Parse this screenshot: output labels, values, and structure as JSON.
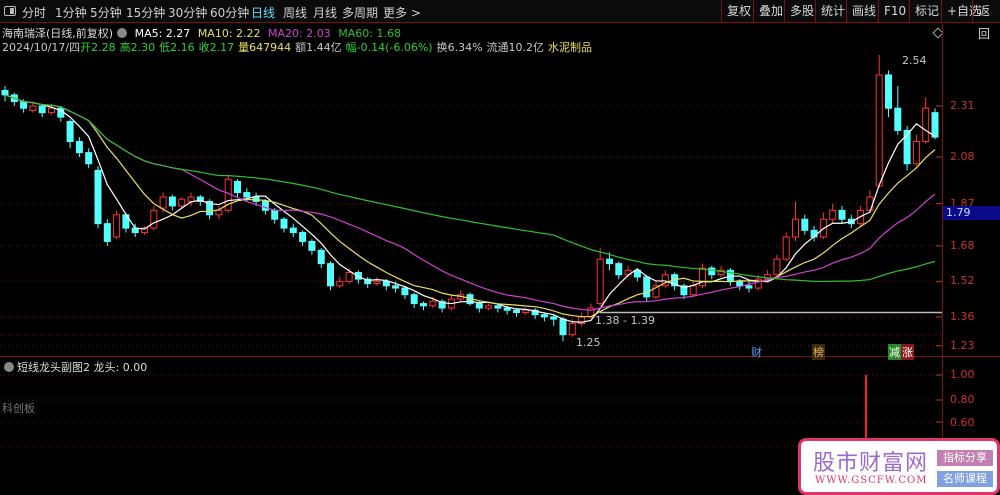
{
  "toolbar": {
    "tabs": [
      "分时",
      "1分钟",
      "5分钟",
      "15分钟",
      "30分钟",
      "60分钟",
      "日线",
      "周线",
      "月线",
      "多周期",
      "更多 >"
    ],
    "active": "日线",
    "right_buttons": [
      "复权",
      "叠加",
      "多股",
      "统计",
      "画线",
      "F10",
      "标记",
      "+自选",
      "返回"
    ]
  },
  "stock": {
    "name": "海南瑞泽(日线,前复权)",
    "ma5": "MA5: 2.27",
    "ma10": "MA10: 2.22",
    "ma20": "MA20: 2.03",
    "ma60": "MA60: 1.68",
    "date": "2024/10/17/四",
    "open": "开2.28",
    "high": "高2.30",
    "low": "低2.16",
    "close": "收2.17",
    "volume": "量647944",
    "amount": "额1.44亿",
    "change": "幅-0.14(-6.06%)",
    "turnover": "换6.34%",
    "float": "流通10.2亿",
    "industry": "水泥制品"
  },
  "colors": {
    "up": "#ff3232",
    "down": "#54ffff",
    "ma5": "#ffffff",
    "ma10": "#e8e060",
    "ma20": "#d040d0",
    "ma60": "#30c030",
    "axis": "#c83030"
  },
  "price_axis": [
    "2.31",
    "2.08",
    "1.87",
    "1.68",
    "1.52",
    "1.36",
    "1.23"
  ],
  "current_price": "1.79",
  "annotations": {
    "high": "2.54",
    "low": "1.25",
    "range": "1.38 - 1.39"
  },
  "flags": [
    "财",
    "榜",
    "减",
    "涨"
  ],
  "sub_pane": {
    "title": "短线龙头副图2",
    "value": "龙头: 0.00",
    "board": "科创板",
    "axis": [
      "1.00",
      "0.80",
      "0.60"
    ],
    "signal_value": 1.0
  },
  "watermark": {
    "title": "股市财富网",
    "url": "WWW.GSCFW.COM",
    "tag1": "指标分享",
    "tag2": "名师课程"
  },
  "chart_data": {
    "type": "candlestick",
    "ylim": [
      1.23,
      2.54
    ],
    "level_line": 1.38,
    "ohlc": [
      [
        2.38,
        2.4,
        2.33,
        2.36
      ],
      [
        2.36,
        2.37,
        2.31,
        2.33
      ],
      [
        2.33,
        2.34,
        2.28,
        2.3
      ],
      [
        2.29,
        2.33,
        2.28,
        2.31
      ],
      [
        2.31,
        2.32,
        2.26,
        2.28
      ],
      [
        2.28,
        2.32,
        2.27,
        2.3
      ],
      [
        2.3,
        2.31,
        2.24,
        2.26
      ],
      [
        2.24,
        2.25,
        2.12,
        2.15
      ],
      [
        2.15,
        2.17,
        2.08,
        2.1
      ],
      [
        2.1,
        2.12,
        2.03,
        2.05
      ],
      [
        2.02,
        2.04,
        1.76,
        1.78
      ],
      [
        1.78,
        1.8,
        1.68,
        1.7
      ],
      [
        1.72,
        1.84,
        1.71,
        1.82
      ],
      [
        1.82,
        1.83,
        1.74,
        1.76
      ],
      [
        1.76,
        1.78,
        1.72,
        1.74
      ],
      [
        1.74,
        1.77,
        1.73,
        1.76
      ],
      [
        1.76,
        1.86,
        1.75,
        1.84
      ],
      [
        1.85,
        1.92,
        1.83,
        1.9
      ],
      [
        1.9,
        1.91,
        1.84,
        1.86
      ],
      [
        1.86,
        1.9,
        1.85,
        1.89
      ],
      [
        1.88,
        1.92,
        1.86,
        1.9
      ],
      [
        1.9,
        1.91,
        1.86,
        1.88
      ],
      [
        1.88,
        1.89,
        1.8,
        1.82
      ],
      [
        1.82,
        1.86,
        1.8,
        1.84
      ],
      [
        1.84,
        2.0,
        1.83,
        1.98
      ],
      [
        1.97,
        1.98,
        1.9,
        1.92
      ],
      [
        1.92,
        1.94,
        1.88,
        1.9
      ],
      [
        1.9,
        1.92,
        1.86,
        1.88
      ],
      [
        1.88,
        1.89,
        1.82,
        1.84
      ],
      [
        1.84,
        1.85,
        1.78,
        1.8
      ],
      [
        1.8,
        1.81,
        1.74,
        1.76
      ],
      [
        1.76,
        1.78,
        1.72,
        1.74
      ],
      [
        1.74,
        1.75,
        1.68,
        1.7
      ],
      [
        1.7,
        1.71,
        1.64,
        1.66
      ],
      [
        1.66,
        1.67,
        1.58,
        1.6
      ],
      [
        1.6,
        1.61,
        1.48,
        1.5
      ],
      [
        1.5,
        1.54,
        1.49,
        1.52
      ],
      [
        1.52,
        1.58,
        1.51,
        1.56
      ],
      [
        1.56,
        1.57,
        1.51,
        1.53
      ],
      [
        1.53,
        1.54,
        1.49,
        1.51
      ],
      [
        1.51,
        1.54,
        1.5,
        1.52
      ],
      [
        1.52,
        1.53,
        1.48,
        1.5
      ],
      [
        1.5,
        1.52,
        1.47,
        1.49
      ],
      [
        1.49,
        1.5,
        1.44,
        1.46
      ],
      [
        1.46,
        1.47,
        1.4,
        1.42
      ],
      [
        1.42,
        1.43,
        1.39,
        1.41
      ],
      [
        1.41,
        1.45,
        1.4,
        1.43
      ],
      [
        1.43,
        1.44,
        1.38,
        1.4
      ],
      [
        1.4,
        1.46,
        1.39,
        1.44
      ],
      [
        1.44,
        1.48,
        1.43,
        1.46
      ],
      [
        1.46,
        1.47,
        1.41,
        1.42
      ],
      [
        1.42,
        1.43,
        1.38,
        1.4
      ],
      [
        1.4,
        1.42,
        1.39,
        1.41
      ],
      [
        1.41,
        1.42,
        1.38,
        1.4
      ],
      [
        1.4,
        1.41,
        1.37,
        1.39
      ],
      [
        1.39,
        1.4,
        1.36,
        1.38
      ],
      [
        1.38,
        1.4,
        1.37,
        1.39
      ],
      [
        1.39,
        1.4,
        1.35,
        1.37
      ],
      [
        1.37,
        1.38,
        1.34,
        1.36
      ],
      [
        1.36,
        1.37,
        1.32,
        1.35
      ],
      [
        1.35,
        1.36,
        1.25,
        1.28
      ],
      [
        1.28,
        1.35,
        1.27,
        1.33
      ],
      [
        1.33,
        1.38,
        1.32,
        1.36
      ],
      [
        1.36,
        1.42,
        1.35,
        1.4
      ],
      [
        1.42,
        1.67,
        1.41,
        1.62
      ],
      [
        1.62,
        1.65,
        1.57,
        1.6
      ],
      [
        1.6,
        1.61,
        1.53,
        1.55
      ],
      [
        1.55,
        1.59,
        1.54,
        1.57
      ],
      [
        1.57,
        1.58,
        1.52,
        1.54
      ],
      [
        1.54,
        1.55,
        1.43,
        1.45
      ],
      [
        1.45,
        1.52,
        1.44,
        1.5
      ],
      [
        1.5,
        1.57,
        1.49,
        1.55
      ],
      [
        1.55,
        1.56,
        1.48,
        1.5
      ],
      [
        1.5,
        1.51,
        1.44,
        1.46
      ],
      [
        1.46,
        1.52,
        1.45,
        1.5
      ],
      [
        1.5,
        1.6,
        1.49,
        1.58
      ],
      [
        1.58,
        1.59,
        1.53,
        1.55
      ],
      [
        1.55,
        1.59,
        1.54,
        1.57
      ],
      [
        1.57,
        1.58,
        1.5,
        1.52
      ],
      [
        1.52,
        1.53,
        1.48,
        1.5
      ],
      [
        1.5,
        1.52,
        1.47,
        1.49
      ],
      [
        1.49,
        1.55,
        1.48,
        1.53
      ],
      [
        1.53,
        1.57,
        1.52,
        1.55
      ],
      [
        1.55,
        1.64,
        1.54,
        1.62
      ],
      [
        1.62,
        1.74,
        1.61,
        1.72
      ],
      [
        1.72,
        1.88,
        1.7,
        1.8
      ],
      [
        1.8,
        1.82,
        1.73,
        1.75
      ],
      [
        1.75,
        1.77,
        1.7,
        1.72
      ],
      [
        1.72,
        1.83,
        1.71,
        1.8
      ],
      [
        1.8,
        1.87,
        1.78,
        1.84
      ],
      [
        1.84,
        1.86,
        1.78,
        1.8
      ],
      [
        1.8,
        1.82,
        1.76,
        1.78
      ],
      [
        1.78,
        1.86,
        1.77,
        1.84
      ],
      [
        1.84,
        1.93,
        1.83,
        1.9
      ],
      [
        1.95,
        2.54,
        1.94,
        2.45
      ],
      [
        2.45,
        2.47,
        2.26,
        2.3
      ],
      [
        2.3,
        2.4,
        2.18,
        2.2
      ],
      [
        2.2,
        2.22,
        2.02,
        2.05
      ],
      [
        2.05,
        2.18,
        2.04,
        2.15
      ],
      [
        2.15,
        2.35,
        2.14,
        2.3
      ],
      [
        2.28,
        2.3,
        2.16,
        2.17
      ]
    ]
  }
}
